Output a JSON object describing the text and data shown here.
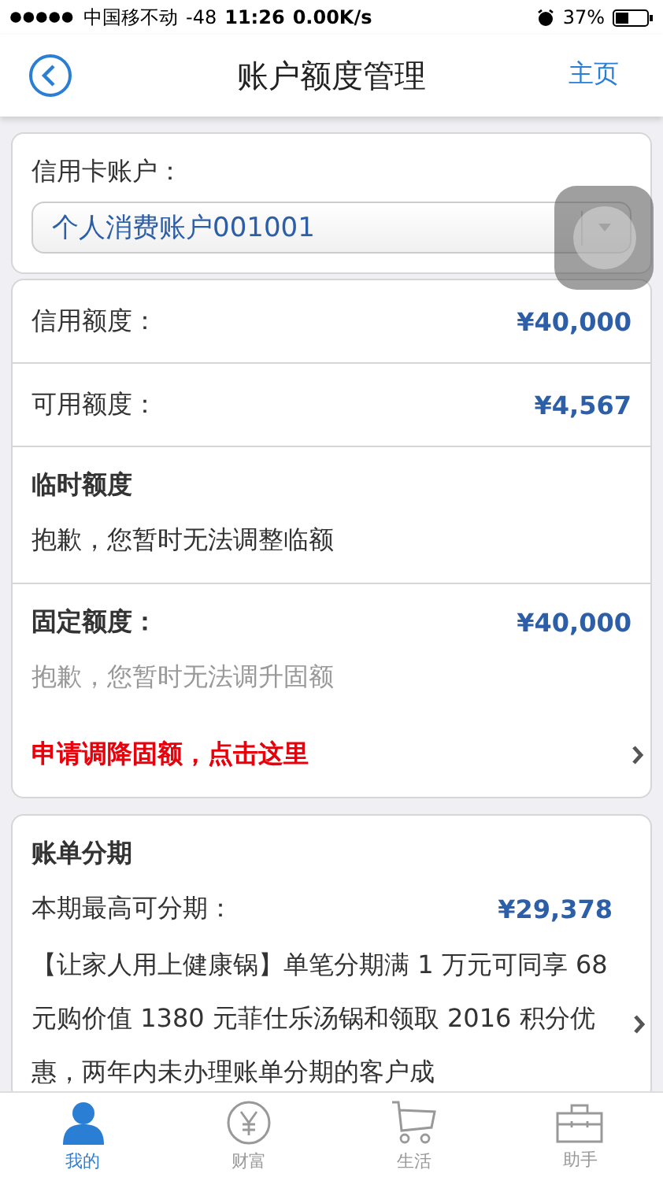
{
  "status_bar": {
    "carrier": "中国移不动",
    "signal_value": "-48",
    "time": "11:26",
    "speed": "0.00K/s",
    "battery_percent": "37%"
  },
  "nav": {
    "title": "账户额度管理",
    "home_link": "主页"
  },
  "account": {
    "label": "信用卡账户：",
    "selected_account": "个人消费账户001001"
  },
  "limits": [
    {
      "kind": "amount",
      "label": "信用额度：",
      "value": "¥40,000"
    },
    {
      "kind": "amount",
      "label": "可用额度：",
      "value": "¥4,567"
    },
    {
      "kind": "notice",
      "label": "临时额度",
      "message": "抱歉，您暂时无法调整临额"
    },
    {
      "kind": "fixed",
      "label": "固定额度：",
      "value": "¥40,000",
      "message": "抱歉，您暂时无法调升固额",
      "link": "申请调降固额，点击这里"
    }
  ],
  "installment": {
    "title": "账单分期",
    "label": "本期最高可分期：",
    "value": "¥29,378",
    "description": "【让家人用上健康锅】单笔分期满 1 万元可同享 68 元购价值 1380 元菲仕乐汤锅和领取 2016 积分优惠，两年内未办理账单分期的客户成"
  },
  "tabs": [
    {
      "kind": "person",
      "label": "我的",
      "selected": true
    },
    {
      "kind": "wealth",
      "label": "财富",
      "selected": false
    },
    {
      "kind": "cart",
      "label": "生活",
      "selected": false
    },
    {
      "kind": "toolbox",
      "label": "助手",
      "selected": false
    }
  ]
}
